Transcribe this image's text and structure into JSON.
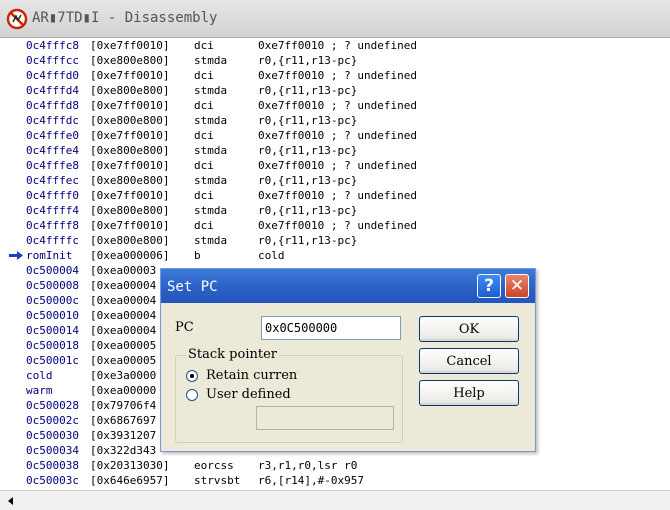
{
  "window": {
    "title": "AR▮7TD▮I - Disassembly",
    "icon": "no-entry-icon"
  },
  "listing": {
    "pc_marker_icon": "arrow-right-icon",
    "rows": [
      {
        "addr": "0c4fffc8",
        "op": "[0xe7ff0010]",
        "mn": "dci",
        "args": "0xe7ff0010 ; ? undefined"
      },
      {
        "addr": "0c4fffcc",
        "op": "[0xe800e800]",
        "mn": "stmda",
        "args": "r0,{r11,r13-pc}"
      },
      {
        "addr": "0c4fffd0",
        "op": "[0xe7ff0010]",
        "mn": "dci",
        "args": "0xe7ff0010 ; ? undefined"
      },
      {
        "addr": "0c4fffd4",
        "op": "[0xe800e800]",
        "mn": "stmda",
        "args": "r0,{r11,r13-pc}"
      },
      {
        "addr": "0c4fffd8",
        "op": "[0xe7ff0010]",
        "mn": "dci",
        "args": "0xe7ff0010 ; ? undefined"
      },
      {
        "addr": "0c4fffdc",
        "op": "[0xe800e800]",
        "mn": "stmda",
        "args": "r0,{r11,r13-pc}"
      },
      {
        "addr": "0c4fffe0",
        "op": "[0xe7ff0010]",
        "mn": "dci",
        "args": "0xe7ff0010 ; ? undefined"
      },
      {
        "addr": "0c4fffe4",
        "op": "[0xe800e800]",
        "mn": "stmda",
        "args": "r0,{r11,r13-pc}"
      },
      {
        "addr": "0c4fffe8",
        "op": "[0xe7ff0010]",
        "mn": "dci",
        "args": "0xe7ff0010 ; ? undefined"
      },
      {
        "addr": "0c4fffec",
        "op": "[0xe800e800]",
        "mn": "stmda",
        "args": "r0,{r11,r13-pc}"
      },
      {
        "addr": "0c4ffff0",
        "op": "[0xe7ff0010]",
        "mn": "dci",
        "args": "0xe7ff0010 ; ? undefined"
      },
      {
        "addr": "0c4ffff4",
        "op": "[0xe800e800]",
        "mn": "stmda",
        "args": "r0,{r11,r13-pc}"
      },
      {
        "addr": "0c4ffff8",
        "op": "[0xe7ff0010]",
        "mn": "dci",
        "args": "0xe7ff0010 ; ? undefined"
      },
      {
        "addr": "0c4ffffc",
        "op": "[0xe800e800]",
        "mn": "stmda",
        "args": "r0,{r11,r13-pc}"
      },
      {
        "addr": "romInit",
        "op": "[0xea000006]",
        "mn": "b",
        "args": "cold",
        "pc": true
      },
      {
        "addr": "0c500004",
        "op": "[0xea00003",
        "mn": "",
        "args": ""
      },
      {
        "addr": "0c500008",
        "op": "[0xea00004",
        "mn": "",
        "args": ""
      },
      {
        "addr": "0c50000c",
        "op": "[0xea00004",
        "mn": "",
        "args": ""
      },
      {
        "addr": "0c500010",
        "op": "[0xea00004",
        "mn": "",
        "args": ""
      },
      {
        "addr": "0c500014",
        "op": "[0xea00004",
        "mn": "",
        "args": ""
      },
      {
        "addr": "0c500018",
        "op": "[0xea00005",
        "mn": "",
        "args": ""
      },
      {
        "addr": "0c50001c",
        "op": "[0xea00005",
        "mn": "",
        "args": ""
      },
      {
        "addr": "cold",
        "op": "[0xe3a0000",
        "mn": "",
        "args": ""
      },
      {
        "addr": "warm",
        "op": "[0xea00000",
        "mn": "",
        "args": ""
      },
      {
        "addr": "0c500028",
        "op": "[0x79706f4",
        "mn": "",
        "args": ""
      },
      {
        "addr": "0c50002c",
        "op": "[0x6867697",
        "mn": "",
        "args": ""
      },
      {
        "addr": "0c500030",
        "op": "[0x3931207",
        "mn": "",
        "args": ""
      },
      {
        "addr": "0c500034",
        "op": "[0x322d343",
        "mn": "",
        "args": ""
      },
      {
        "addr": "0c500038",
        "op": "[0x20313030]",
        "mn": "eorcss",
        "args": "r3,r1,r0,lsr r0"
      },
      {
        "addr": "0c50003c",
        "op": "[0x646e6957]",
        "mn": "strvsbt",
        "args": "r6,[r14],#-0x957"
      }
    ]
  },
  "dialog": {
    "title": "Set PC",
    "help_glyph": "?",
    "close_glyph": "✕",
    "pc_label": "PC",
    "pc_value": "0x0C500000",
    "stack_group_label": "Stack pointer",
    "radio_retain_label": "Retain current",
    "radio_user_label": "User defined",
    "selected_radio": "retain",
    "user_sp_value": "",
    "ok_label": "OK",
    "cancel_label": "Cancel",
    "help_label": "Help"
  }
}
